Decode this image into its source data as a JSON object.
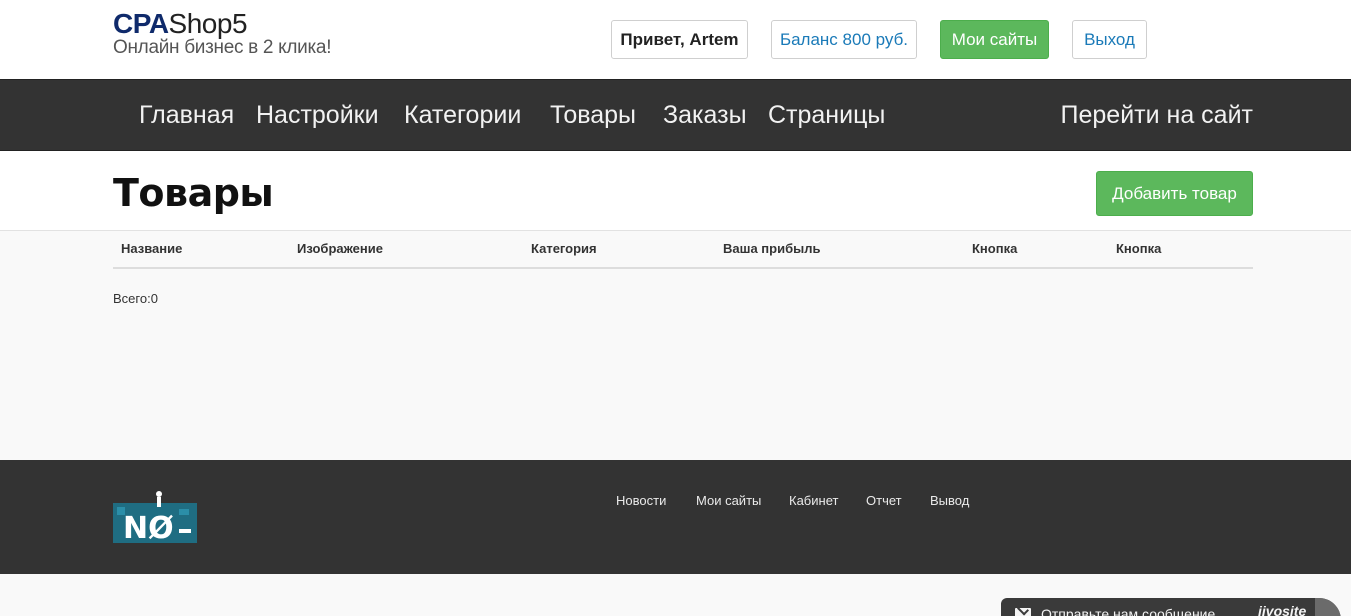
{
  "header": {
    "logo_cpa": "CPA",
    "logo_shop": "Shop5",
    "tagline": "Онлайн бизнес в 2 клика!",
    "greeting": "Привет, Artem",
    "balance": "Баланс 800 руб.",
    "my_sites": "Мои сайты",
    "logout": "Выход"
  },
  "nav": {
    "items": [
      "Главная",
      "Настройки",
      "Категории",
      "Товары",
      "Заказы",
      "Страницы"
    ],
    "goto_site": "Перейти на сайт"
  },
  "page": {
    "title": "Товары",
    "add_button": "Добавить товар"
  },
  "table": {
    "columns": [
      "Название",
      "Изображение",
      "Категория",
      "Ваша прибыль",
      "Кнопка",
      "Кнопка"
    ],
    "rows": [],
    "total": "Всего:0"
  },
  "footer": {
    "links": [
      "Новости",
      "Мои сайты",
      "Кабинет",
      "Отчет",
      "Вывод"
    ]
  },
  "chat": {
    "text": "Отправьте нам сообщение",
    "brand": "jivosite"
  },
  "colors": {
    "accent_green": "#5cb85c",
    "link_blue": "#1a7ab8",
    "nav_bg": "#333333",
    "logo_blue": "#0f2a6b"
  }
}
